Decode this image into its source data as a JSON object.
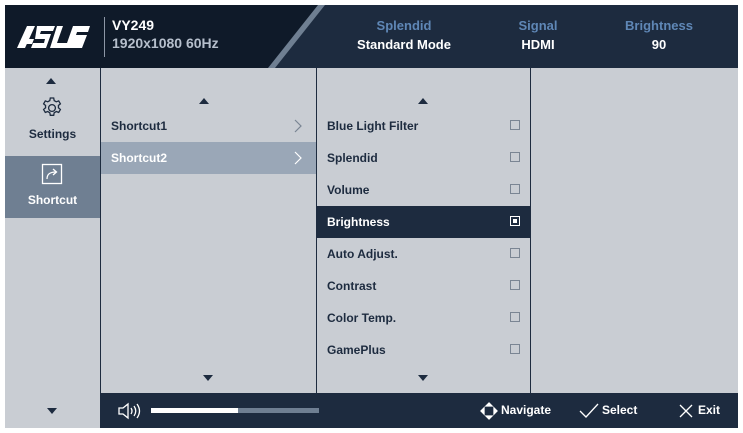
{
  "header": {
    "brand": "ASUS",
    "model": "VY249",
    "resolution": "1920x1080 60Hz",
    "stats": [
      {
        "label": "Splendid",
        "value": "Standard Mode"
      },
      {
        "label": "Signal",
        "value": "HDMI"
      },
      {
        "label": "Brightness",
        "value": "90"
      }
    ]
  },
  "sidebar": {
    "items": [
      {
        "label": "Settings",
        "icon": "gear-icon",
        "active": false
      },
      {
        "label": "Shortcut",
        "icon": "shortcut-arrow-icon",
        "active": true
      }
    ]
  },
  "shortcut_menu": {
    "items": [
      {
        "label": "Shortcut1",
        "selected": false
      },
      {
        "label": "Shortcut2",
        "selected": true
      }
    ]
  },
  "function_list": {
    "items": [
      {
        "label": "Blue Light Filter",
        "checked": false
      },
      {
        "label": "Splendid",
        "checked": false
      },
      {
        "label": "Volume",
        "checked": false
      },
      {
        "label": "Brightness",
        "checked": true
      },
      {
        "label": "Auto Adjust.",
        "checked": false
      },
      {
        "label": "Contrast",
        "checked": false
      },
      {
        "label": "Color Temp.",
        "checked": false
      },
      {
        "label": "GamePlus",
        "checked": false
      }
    ]
  },
  "footer": {
    "volume_level": 0.52,
    "hints": [
      {
        "label": "Navigate",
        "icon": "navigate-icon"
      },
      {
        "label": "Select",
        "icon": "checkmark-icon"
      },
      {
        "label": "Exit",
        "icon": "close-icon"
      }
    ]
  },
  "colors": {
    "header_dark": "#0f1a29",
    "header": "#1d2b3f",
    "panel": "#c9cdd3",
    "accent_label": "#5f87b6",
    "selected_row": "#1d2b3f",
    "hover_row": "#9aa7b7"
  }
}
